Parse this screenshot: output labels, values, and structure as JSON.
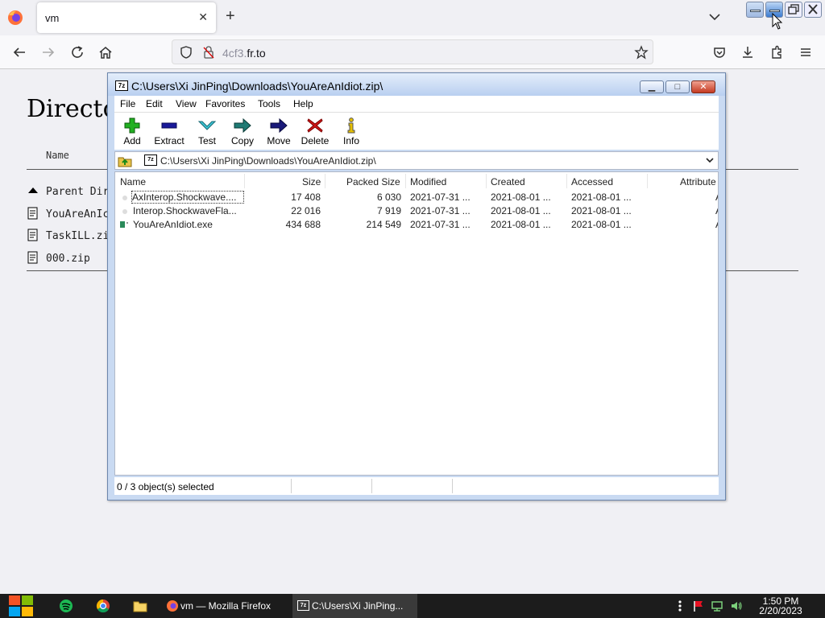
{
  "browser": {
    "tab_title": "vm",
    "new_tab_symbol": "+",
    "url_prefix": "4cf3.",
    "url_domain": "fr.to",
    "accent": "#0060df"
  },
  "webpage": {
    "heading_partial": "Directo",
    "column_name": "Name",
    "rows": [
      {
        "label": "Parent Dir",
        "icon": "up-arrow-icon"
      },
      {
        "label": "YouAreAnIc",
        "icon": "document-icon"
      },
      {
        "label": "TaskILL.zi",
        "icon": "document-icon"
      },
      {
        "label": "000.zip",
        "icon": "document-icon"
      }
    ]
  },
  "zip": {
    "title": "C:\\Users\\Xi JinPing\\Downloads\\YouAreAnIdiot.zip\\",
    "menu": [
      "File",
      "Edit",
      "View",
      "Favorites",
      "Tools",
      "Help"
    ],
    "toolbar": [
      {
        "label": "Add",
        "icon": "plus-icon",
        "color": "#1ea01e"
      },
      {
        "label": "Extract",
        "icon": "minus-icon",
        "color": "#1a1a9a"
      },
      {
        "label": "Test",
        "icon": "check-down-icon",
        "color": "#3bb8c8"
      },
      {
        "label": "Copy",
        "icon": "right-arrow-icon",
        "color": "#1f7a74"
      },
      {
        "label": "Move",
        "icon": "right-arrow-icon",
        "color": "#1a1a7a"
      },
      {
        "label": "Delete",
        "icon": "x-icon",
        "color": "#d01818"
      },
      {
        "label": "Info",
        "icon": "info-icon",
        "color": "#e6c000"
      }
    ],
    "address": "C:\\Users\\Xi JinPing\\Downloads\\YouAreAnIdiot.zip\\",
    "columns": [
      "Name",
      "Size",
      "Packed Size",
      "Modified",
      "Created",
      "Accessed",
      "Attribute"
    ],
    "files": [
      {
        "name": "AxInterop.Shockwave....",
        "size": "17 408",
        "packed": "6 030",
        "modified": "2021-07-31 ...",
        "created": "2021-08-01 ...",
        "accessed": "2021-08-01 ...",
        "attr": "A"
      },
      {
        "name": "Interop.ShockwaveFla...",
        "size": "22 016",
        "packed": "7 919",
        "modified": "2021-07-31 ...",
        "created": "2021-08-01 ...",
        "accessed": "2021-08-01 ...",
        "attr": "A"
      },
      {
        "name": "YouAreAnIdiot.exe",
        "size": "434 688",
        "packed": "214 549",
        "modified": "2021-07-31 ...",
        "created": "2021-08-01 ...",
        "accessed": "2021-08-01 ...",
        "attr": "A"
      }
    ],
    "status": "0 / 3 object(s) selected"
  },
  "taskbar": {
    "tasks": [
      {
        "label": "vm — Mozilla Firefox"
      },
      {
        "label": "C:\\Users\\Xi JinPing..."
      }
    ],
    "time": "1:50 PM",
    "date": "2/20/2023"
  }
}
